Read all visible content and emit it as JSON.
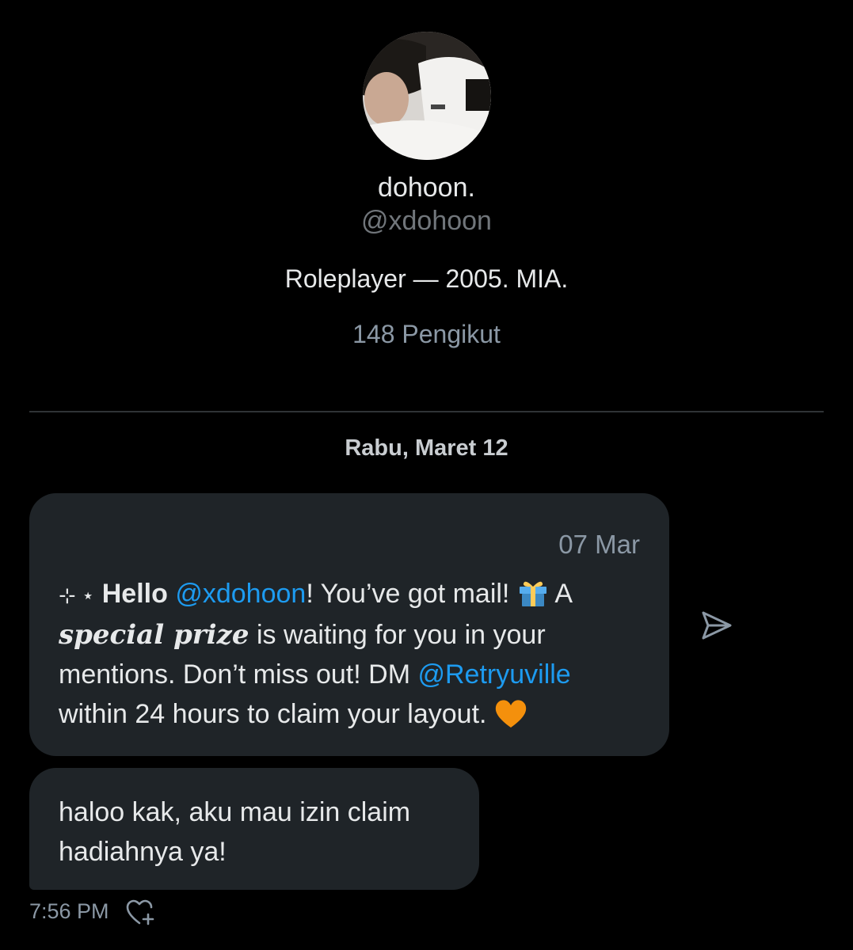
{
  "profile": {
    "display_name": "dohoon.",
    "handle": "@xdohoon",
    "bio": "Roleplayer — 2005. MIA.",
    "followers": "148 Pengikut"
  },
  "date_separator": "Rabu, Maret 12",
  "messages": [
    {
      "type": "received",
      "date": "07 Mar",
      "sparkle": "⊹ ⋆",
      "hello": "Hello",
      "mention1": "@xdohoon",
      "text1": "! You’ve got mail!",
      "text2": " A",
      "special": "special prize",
      "text3": " is waiting for you in your mentions. Don’t miss out! DM ",
      "mention2": "@Retryuville",
      "text4": " within 24 hours to claim your layout. "
    },
    {
      "type": "sent",
      "text": "haloo kak, aku mau izin claim hadiahnya ya!",
      "time": "7:56 PM"
    }
  ],
  "icons": {
    "gift": "gift-icon",
    "heart": "orange-heart-icon",
    "send": "send-icon",
    "react": "heart-plus-icon"
  },
  "colors": {
    "background": "#000000",
    "bubble": "#1f2428",
    "mention": "#1d9bf0",
    "muted": "#71767b",
    "heart": "#f4900c"
  }
}
